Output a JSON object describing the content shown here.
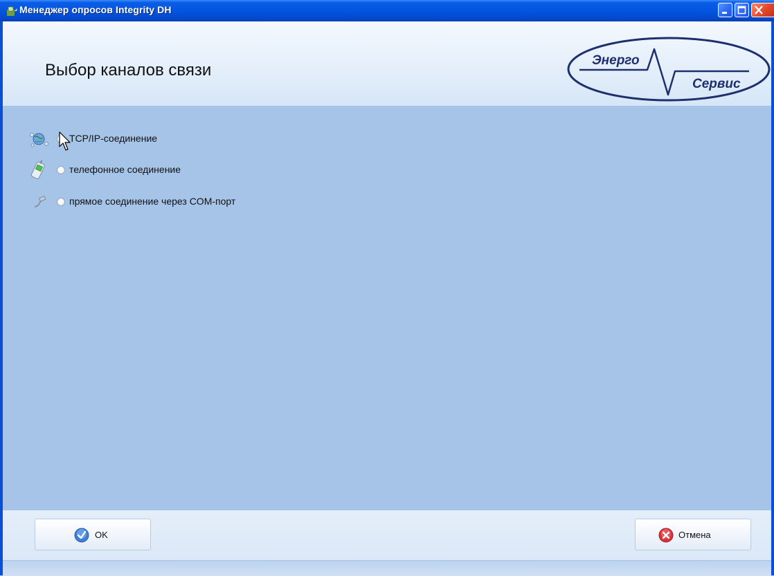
{
  "window": {
    "title": "Менеджер опросов Integrity DH",
    "minimize_icon": "minimize-icon",
    "maximize_icon": "maximize-icon",
    "close_icon": "close-icon"
  },
  "header": {
    "title": "Выбор каналов связи",
    "logo": {
      "top_text": "Энерго",
      "bottom_text": "Сервис"
    }
  },
  "options": [
    {
      "label": "TCP/IP-соединение",
      "icon": "network-globe-icon",
      "selected": true
    },
    {
      "label": "телефонное соединение",
      "icon": "mobile-phone-icon",
      "selected": false
    },
    {
      "label": "прямое соединение через COM-порт",
      "icon": "com-port-plug-icon",
      "selected": false
    }
  ],
  "buttons": {
    "ok_label": "OK",
    "cancel_label": "Отмена"
  },
  "colors": {
    "titlebar": "#0455e0",
    "main_background": "#a6c4e8",
    "header_background": "#e3eefa",
    "logo_color": "#1e2f6e"
  }
}
